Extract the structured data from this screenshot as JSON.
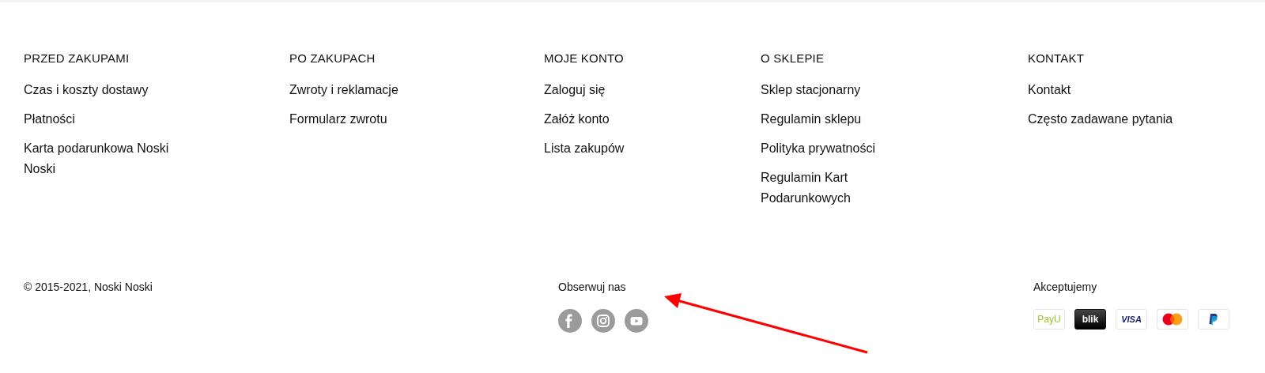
{
  "columns": [
    {
      "heading": "PRZED ZAKUPAMI",
      "links": [
        "Czas i koszty dostawy",
        "Płatności",
        "Karta podarunkowa Noski Noski"
      ]
    },
    {
      "heading": "PO ZAKUPACH",
      "links": [
        "Zwroty i reklamacje",
        "Formularz zwrotu"
      ]
    },
    {
      "heading": "MOJE KONTO",
      "links": [
        "Zaloguj się",
        "Załóż konto",
        "Lista zakupów"
      ]
    },
    {
      "heading": "O SKLEPIE",
      "links": [
        "Sklep stacjonarny",
        "Regulamin sklepu",
        "Polityka prywatności",
        "Regulamin Kart Podarunkowych"
      ]
    },
    {
      "heading": "KONTAKT",
      "links": [
        "Kontakt",
        "Często zadawane pytania"
      ]
    }
  ],
  "copyright": "© 2015-2021, Noski Noski",
  "social": {
    "title": "Obserwuj nas",
    "links": [
      {
        "kind": "facebook"
      },
      {
        "kind": "instagram"
      },
      {
        "kind": "youtube"
      }
    ]
  },
  "payments": {
    "title": "Akceptujemy",
    "methods": [
      {
        "kind": "payu",
        "label": "PayU"
      },
      {
        "kind": "blik",
        "label": "blik"
      },
      {
        "kind": "visa",
        "label": "VISA"
      },
      {
        "kind": "mastercard"
      },
      {
        "kind": "paypal"
      }
    ]
  }
}
